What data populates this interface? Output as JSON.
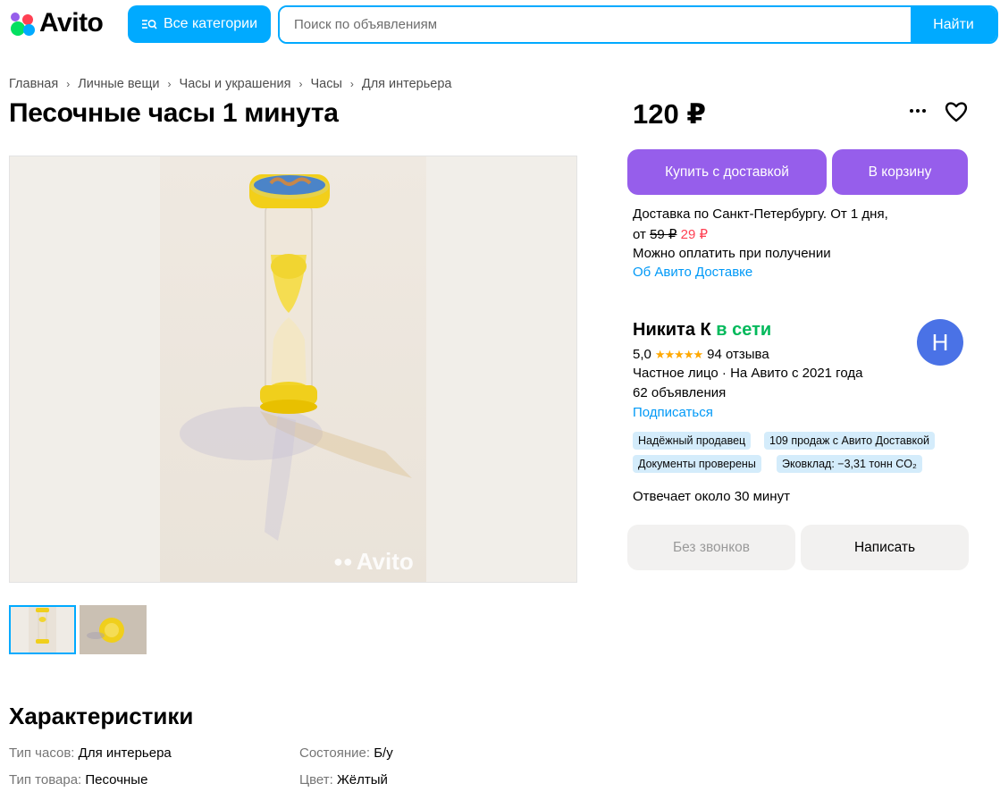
{
  "header": {
    "logo_text": "Avito",
    "categories_label": "Все категории",
    "search_placeholder": "Поиск по объявлениям",
    "search_button": "Найти"
  },
  "breadcrumbs": [
    "Главная",
    "Личные вещи",
    "Часы и украшения",
    "Часы",
    "Для интерьера"
  ],
  "listing": {
    "title": "Песочные часы 1 минута",
    "price": "120 ₽",
    "watermark": "Avito",
    "thumbnails": [
      "photo-1",
      "photo-2"
    ]
  },
  "actions": {
    "buy_delivery": "Купить с доставкой",
    "add_to_cart": "В корзину"
  },
  "delivery": {
    "line1": "Доставка по Санкт-Петербургу. От 1 дня,",
    "from_label": "от",
    "old_price": "59 ₽",
    "new_price": "29 ₽",
    "pay_on_receipt": "Можно оплатить при получении",
    "about_link": "Об Авито Доставке"
  },
  "seller": {
    "name": "Никита К",
    "status": "в сети",
    "avatar_letter": "Н",
    "rating": "5,0",
    "stars": "★★★★★",
    "reviews": "94 отзыва",
    "type": "Частное лицо · На Авито с 2021 года",
    "ads_count": "62 объявления",
    "subscribe": "Подписаться",
    "badges": [
      "Надёжный продавец",
      "109 продаж с Авито Доставкой",
      "Документы проверены",
      "Эковклад: −3,31 тонн CO₂"
    ],
    "response_time": "Отвечает около 30 минут",
    "no_calls": "Без звонков",
    "write": "Написать"
  },
  "characteristics": {
    "title": "Характеристики",
    "items": [
      {
        "key": "Тип часов:",
        "value": "Для интерьера"
      },
      {
        "key": "Состояние:",
        "value": "Б/у"
      },
      {
        "key": "Тип товара:",
        "value": "Песочные"
      },
      {
        "key": "Цвет:",
        "value": "Жёлтый"
      }
    ]
  },
  "colors": {
    "accent_blue": "#00aaff",
    "purple": "#965eeb",
    "online_green": "#02b95b",
    "price_red": "#ff4053",
    "link_blue": "#0099f7",
    "star": "#ffa800"
  }
}
